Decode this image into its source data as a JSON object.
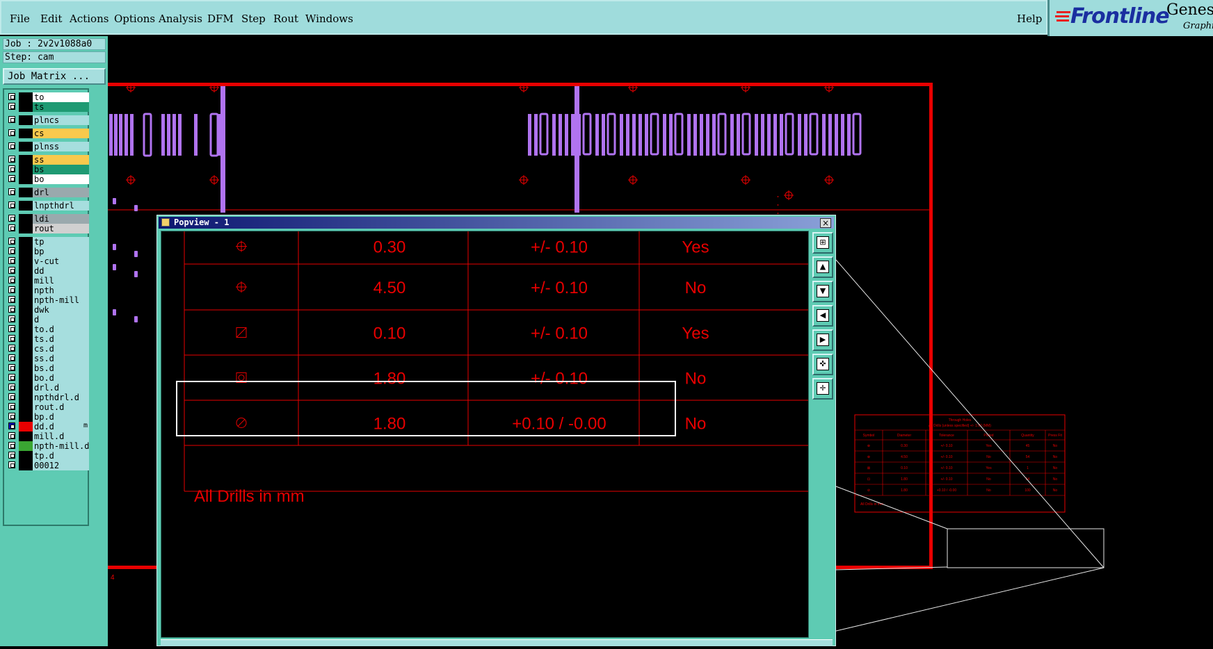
{
  "menu": {
    "file": "File",
    "edit": "Edit",
    "actions": "Actions",
    "options": "Options",
    "analysis": "Analysis",
    "dfm": "DFM",
    "step": "Step",
    "rout": "Rout",
    "windows": "Windows",
    "help": "Help"
  },
  "logo": {
    "brand": "Frontline",
    "product": "Genesis",
    "tagline": "Graphics"
  },
  "job": {
    "job_label": "Job : 2v2v1088a0",
    "step_label": "Step: cam",
    "matrix_button": "Job Matrix ..."
  },
  "layers": [
    {
      "name": "to",
      "color": "#ffffff"
    },
    {
      "name": "ts",
      "color": "#1f9a73"
    },
    {
      "name": "plncs",
      "color": "#a6dede"
    },
    {
      "name": "cs",
      "color": "#f9c94d"
    },
    {
      "name": "plnss",
      "color": "#a6dede"
    },
    {
      "name": "ss",
      "color": "#f9c94d"
    },
    {
      "name": "bs",
      "color": "#1f9a73"
    },
    {
      "name": "bo",
      "color": "#ffffff"
    },
    {
      "name": "drl",
      "color": "#9aa9ad"
    },
    {
      "name": "lnpthdrl",
      "color": "#a6dede"
    },
    {
      "name": "ldi",
      "color": "#9aa9ad"
    },
    {
      "name": "rout",
      "color": "#d0d0d0"
    },
    {
      "name": "tp",
      "color": "#a6dede"
    },
    {
      "name": "bp",
      "color": "#a6dede"
    },
    {
      "name": "v-cut",
      "color": "#a6dede"
    },
    {
      "name": "dd",
      "color": "#a6dede"
    },
    {
      "name": "mill",
      "color": "#a6dede"
    },
    {
      "name": "npth",
      "color": "#a6dede"
    },
    {
      "name": "npth-mill",
      "color": "#a6dede"
    },
    {
      "name": "dwk",
      "color": "#a6dede"
    },
    {
      "name": "d",
      "color": "#a6dede"
    },
    {
      "name": "to.d",
      "color": "#a6dede"
    },
    {
      "name": "ts.d",
      "color": "#a6dede"
    },
    {
      "name": "cs.d",
      "color": "#a6dede"
    },
    {
      "name": "ss.d",
      "color": "#a6dede"
    },
    {
      "name": "bs.d",
      "color": "#a6dede"
    },
    {
      "name": "bo.d",
      "color": "#a6dede"
    },
    {
      "name": "drl.d",
      "color": "#a6dede"
    },
    {
      "name": "npthdrl.d",
      "color": "#a6dede"
    },
    {
      "name": "rout.d",
      "color": "#a6dede"
    },
    {
      "name": "bp.d",
      "color": "#a6dede"
    },
    {
      "name": "dd.d",
      "color": "#a6dede",
      "swatch": "#e80000",
      "mark": "m"
    },
    {
      "name": "mill.d",
      "color": "#a6dede"
    },
    {
      "name": "npth-mill.d",
      "color": "#a6dede",
      "swatch": "#3aa632"
    },
    {
      "name": "tp.d",
      "color": "#a6dede"
    },
    {
      "name": "00012",
      "color": "#a6dede"
    }
  ],
  "popview": {
    "title": "Popview - 1",
    "close": "×",
    "rows": [
      {
        "symbol": "circle-cross",
        "diameter": "0.30",
        "tolerance": "+/- 0.10",
        "plated": "Yes"
      },
      {
        "symbol": "circle-cross",
        "diameter": "4.50",
        "tolerance": "+/- 0.10",
        "plated": "No"
      },
      {
        "symbol": "square-diagonal",
        "diameter": "0.10",
        "tolerance": "+/- 0.10",
        "plated": "Yes"
      },
      {
        "symbol": "square-circle",
        "diameter": "1.80",
        "tolerance": "+/- 0.10",
        "plated": "No"
      },
      {
        "symbol": "circle-slash",
        "diameter": "1.80",
        "tolerance": "+0.10 / -0.00",
        "plated": "No"
      }
    ],
    "footer_note": "All Drills in mm",
    "tools": [
      "zoom-box-icon",
      "pan-up-icon",
      "pan-down-icon",
      "pan-left-icon",
      "pan-right-icon",
      "zoom-fit-icon",
      "zoom-center-icon"
    ]
  },
  "thumbnail_table": {
    "title": "Through Holes",
    "subtitle": "All Drills (unless specified) +/- 1.60 (MM)",
    "headers": [
      "Symbol",
      "Diameter",
      "Tolerance",
      "Plated",
      "Quantity",
      "Press Fit"
    ],
    "rows": [
      [
        "⊕",
        "0.30",
        "+/- 0.10",
        "Yes",
        "45",
        "No"
      ],
      [
        "⊕",
        "4.50",
        "+/- 0.10",
        "No",
        "54",
        "No"
      ],
      [
        "⊠",
        "0.10",
        "+/- 0.10",
        "Yes",
        "1",
        "No"
      ],
      [
        "⊡",
        "1.80",
        "+/- 0.10",
        "No",
        "54",
        "No"
      ],
      [
        "⊘",
        "1.80",
        "+0.10 / -0.00",
        "No",
        "100",
        "No"
      ]
    ],
    "footer": "All Drills in mm"
  },
  "canvas_marker": "4"
}
